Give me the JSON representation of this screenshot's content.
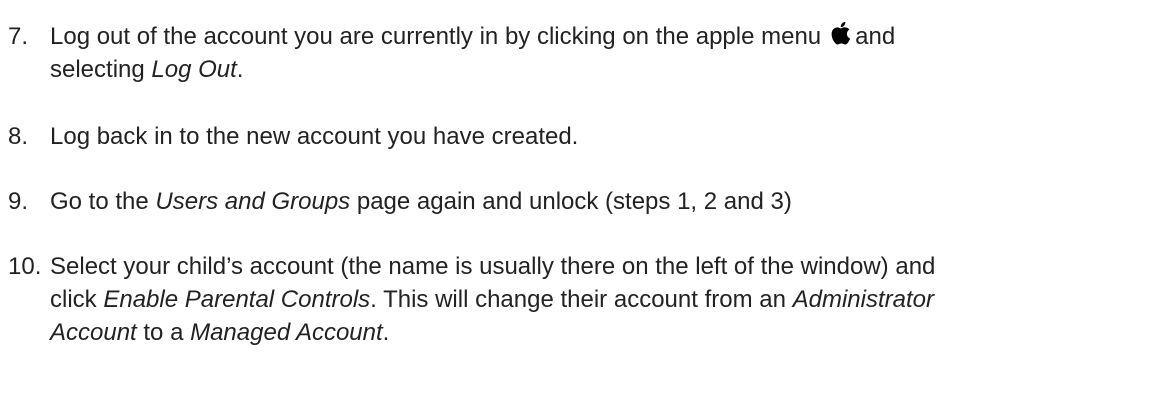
{
  "steps": [
    {
      "number": "7.",
      "line1_pre": "Log out of the account you are currently in by clicking on the apple menu",
      "line1_post": "and",
      "line2_pre": "selecting ",
      "line2_italic": "Log Out",
      "line2_post": "."
    },
    {
      "number": "8.",
      "text": "Log back in to the new account you have created."
    },
    {
      "number": "9.",
      "pre": "Go to the ",
      "italic": "Users and Groups",
      "post": " page again and unlock (steps 1, 2 and 3)"
    },
    {
      "number": "10.",
      "line1": "Select your child’s account (the name is usually there on the left of the window) and",
      "line2_pre": "click ",
      "line2_italic1": "Enable Parental Controls",
      "line2_mid": ". This will change their account from an ",
      "line2_italic2": "Administrator",
      "line3_italic1": "Account",
      "line3_mid": " to a ",
      "line3_italic2": "Managed Account",
      "line3_post": "."
    }
  ],
  "icons": {
    "apple_menu": "apple-logo-icon",
    "apple_color": "#000000"
  },
  "text_color": "#222222"
}
